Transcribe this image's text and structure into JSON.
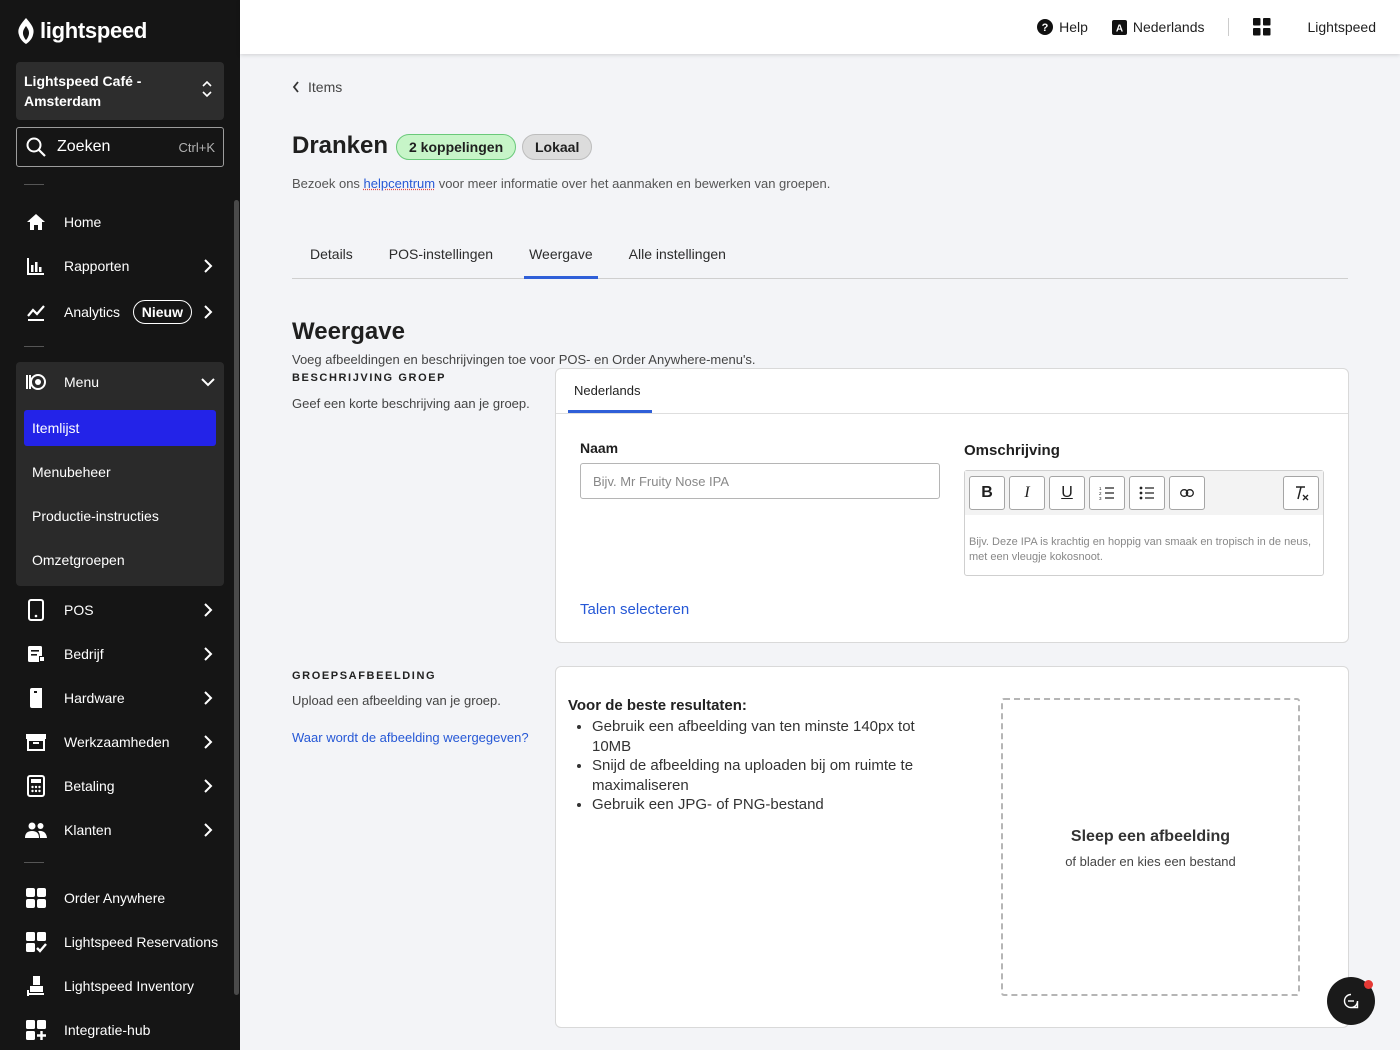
{
  "brand": {
    "logo_text": "lightspeed"
  },
  "store_selector": {
    "name": "Lightspeed Café - Amsterdam"
  },
  "search": {
    "label": "Zoeken",
    "shortcut": "Ctrl+K"
  },
  "sidebar": {
    "home": "Home",
    "rapporten": "Rapporten",
    "analytics": "Analytics",
    "analytics_badge": "Nieuw",
    "menu": "Menu",
    "menu_children": [
      "Itemlijst",
      "Menubeheer",
      "Productie-instructies",
      "Omzetgroepen"
    ],
    "pos": "POS",
    "bedrijf": "Bedrijf",
    "hardware": "Hardware",
    "werkzaamheden": "Werkzaamheden",
    "betaling": "Betaling",
    "klanten": "Klanten",
    "order_anywhere": "Order Anywhere",
    "reservations": "Lightspeed Reservations",
    "inventory": "Lightspeed Inventory",
    "integratie": "Integratie-hub"
  },
  "topbar": {
    "help": "Help",
    "language": "Nederlands",
    "account": "Lightspeed"
  },
  "breadcrumb": {
    "back": "Items"
  },
  "page": {
    "title": "Dranken",
    "badge_links": "2 koppelingen",
    "badge_local": "Lokaal",
    "intro_before": "Bezoek ons ",
    "intro_link": "helpcentrum",
    "intro_after": " voor meer informatie over het aanmaken en bewerken van groepen."
  },
  "tabs": [
    "Details",
    "POS-instellingen",
    "Weergave",
    "Alle instellingen"
  ],
  "active_tab": "Weergave",
  "weergave": {
    "title": "Weergave",
    "subtitle": "Voeg afbeeldingen en beschrijvingen toe voor POS- en Order Anywhere-menu's."
  },
  "description_section": {
    "heading": "BESCHRIJVING GROEP",
    "desc": "Geef een korte beschrijving aan je groep.",
    "language_tab": "Nederlands",
    "name_label": "Naam",
    "name_placeholder": "Bijv. Mr Fruity Nose IPA",
    "name_value": "",
    "omschrijving_label": "Omschrijving",
    "omschrijving_placeholder": "Bijv. Deze IPA is krachtig en hoppig van smaak en tropisch in de neus, met een vleugje kokosnoot.",
    "talen_link": "Talen selecteren",
    "toolbar": {
      "bold": "B",
      "italic": "I",
      "underline": "U"
    }
  },
  "image_section": {
    "heading": "GROEPSAFBEELDING",
    "desc": "Upload een afbeelding van je groep.",
    "help_link": "Waar wordt de afbeelding weergegeven?",
    "tips_title": "Voor de beste resultaten:",
    "tips": [
      "Gebruik een afbeelding van ten minste 140px tot 10MB",
      "Snijd de afbeelding na uploaden bij om ruimte te maximaliseren",
      "Gebruik een JPG- of PNG-bestand"
    ],
    "dropzone_title": "Sleep een afbeelding",
    "dropzone_sub": "of blader en kies een bestand"
  },
  "colors": {
    "accent": "#2323e8",
    "link": "#2658d6",
    "sidebar_bg": "#151515",
    "success_badge": "#c7f5c8"
  }
}
